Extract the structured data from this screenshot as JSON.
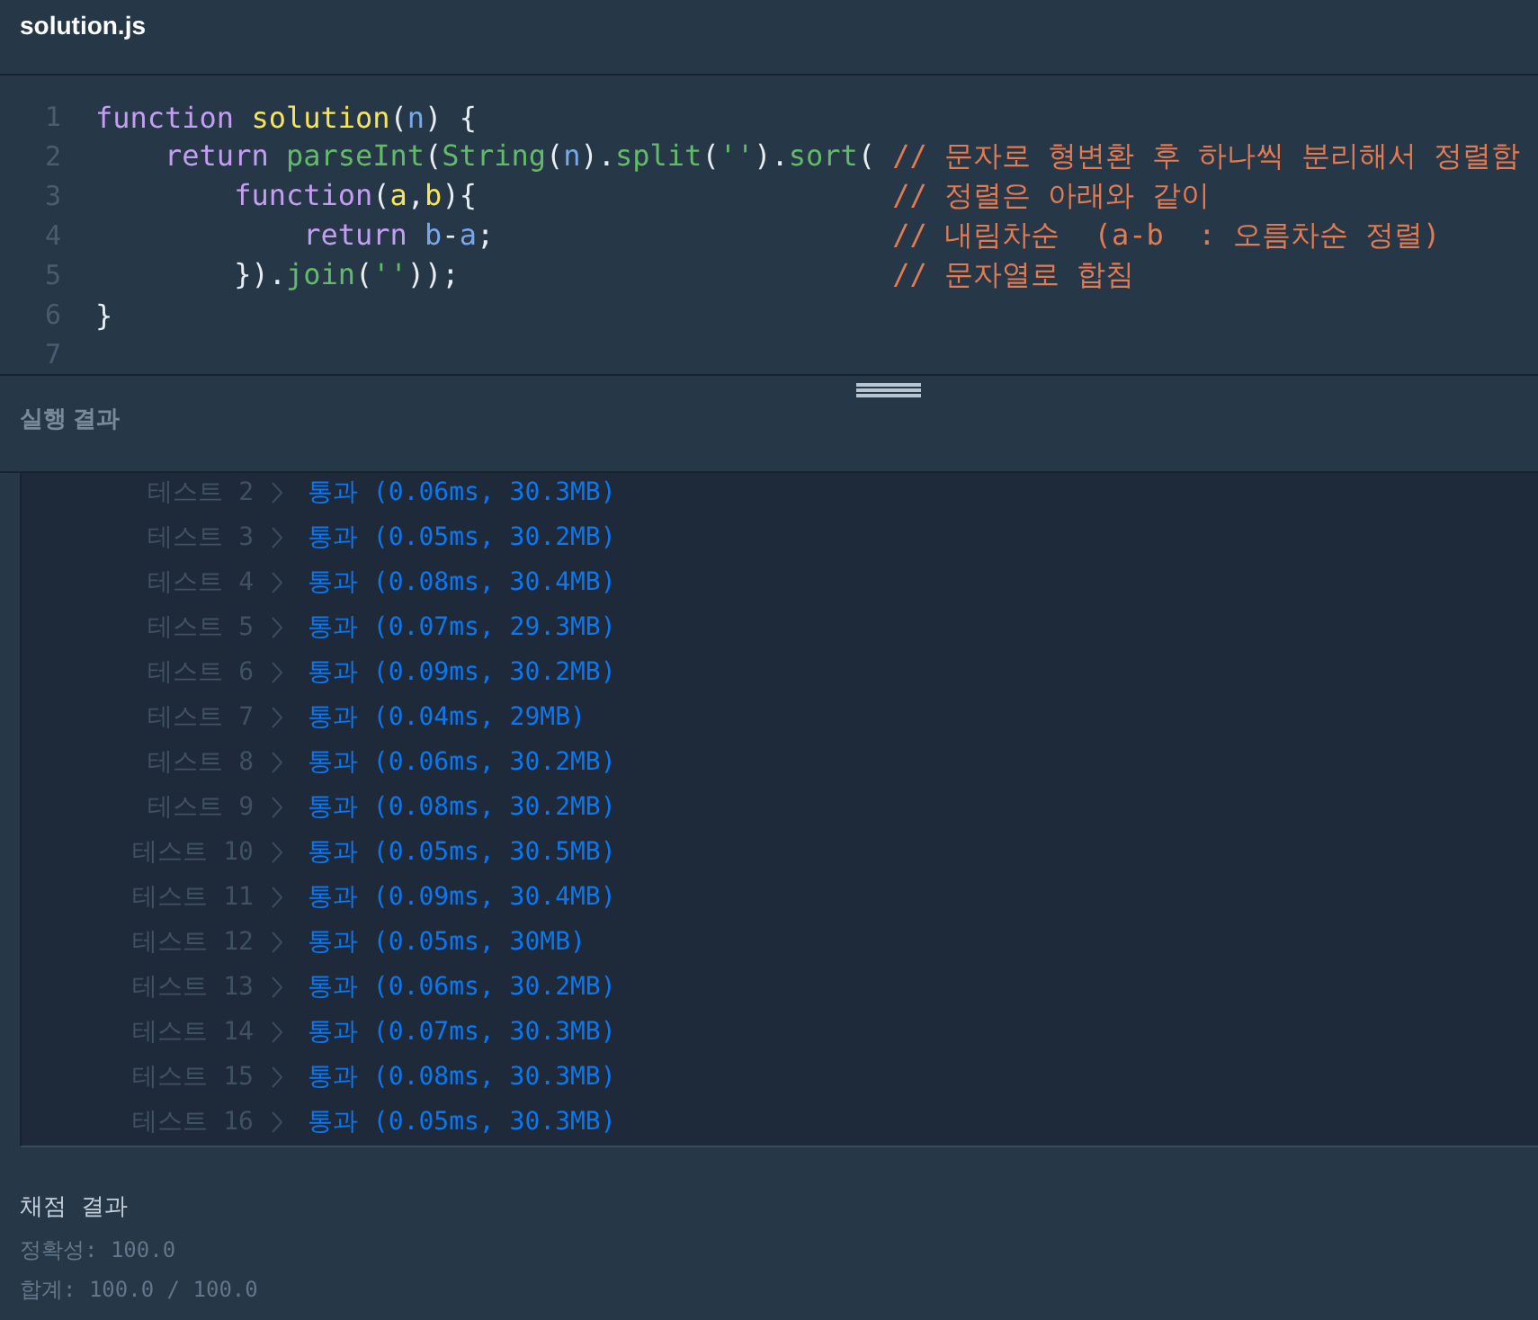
{
  "file_tab": {
    "title": "solution.js"
  },
  "editor": {
    "lines": [
      {
        "number": "1",
        "tokens": [
          {
            "kind": "keyword",
            "text": "function "
          },
          {
            "kind": "name",
            "text": "solution"
          },
          {
            "kind": "punct",
            "text": "("
          },
          {
            "kind": "param",
            "text": "n"
          },
          {
            "kind": "punct",
            "text": ") {"
          }
        ]
      },
      {
        "number": "2",
        "tokens": [
          {
            "kind": "keyword",
            "text": "    return "
          },
          {
            "kind": "call",
            "text": "parseInt"
          },
          {
            "kind": "punct",
            "text": "("
          },
          {
            "kind": "call",
            "text": "String"
          },
          {
            "kind": "punct",
            "text": "("
          },
          {
            "kind": "param",
            "text": "n"
          },
          {
            "kind": "punct",
            "text": ")."
          },
          {
            "kind": "call",
            "text": "split"
          },
          {
            "kind": "punct",
            "text": "("
          },
          {
            "kind": "call",
            "text": "''"
          },
          {
            "kind": "punct",
            "text": ")."
          },
          {
            "kind": "call",
            "text": "sort"
          },
          {
            "kind": "punct",
            "text": "( "
          },
          {
            "kind": "comment",
            "text": "// 문자로 형변환 후 하나씩 분리해서 정렬함"
          }
        ]
      },
      {
        "number": "3",
        "tokens": [
          {
            "kind": "keyword",
            "text": "        function"
          },
          {
            "kind": "punct",
            "text": "("
          },
          {
            "kind": "name",
            "text": "a"
          },
          {
            "kind": "punct",
            "text": ","
          },
          {
            "kind": "name",
            "text": "b"
          },
          {
            "kind": "punct",
            "text": "){                        "
          },
          {
            "kind": "comment",
            "text": "// 정렬은 아래와 같이"
          }
        ]
      },
      {
        "number": "4",
        "tokens": [
          {
            "kind": "keyword",
            "text": "            return "
          },
          {
            "kind": "param",
            "text": "b"
          },
          {
            "kind": "punct",
            "text": "-"
          },
          {
            "kind": "param",
            "text": "a"
          },
          {
            "kind": "punct",
            "text": ";                       "
          },
          {
            "kind": "comment",
            "text": "// 내림차순  (a-b  : 오름차순 정렬)"
          }
        ]
      },
      {
        "number": "5",
        "tokens": [
          {
            "kind": "punct",
            "text": "        })."
          },
          {
            "kind": "call",
            "text": "join"
          },
          {
            "kind": "punct",
            "text": "("
          },
          {
            "kind": "call",
            "text": "''"
          },
          {
            "kind": "punct",
            "text": "));                         "
          },
          {
            "kind": "comment",
            "text": "// 문자열로 합침"
          }
        ]
      },
      {
        "number": "6",
        "tokens": [
          {
            "kind": "punct",
            "text": "}"
          }
        ]
      },
      {
        "number": "7"
      }
    ]
  },
  "run_result": {
    "title": "실행 결과",
    "rows": [
      {
        "label": "테스트 2",
        "result": "통과 (0.06ms, 30.3MB)"
      },
      {
        "label": "테스트 3",
        "result": "통과 (0.05ms, 30.2MB)"
      },
      {
        "label": "테스트 4",
        "result": "통과 (0.08ms, 30.4MB)"
      },
      {
        "label": "테스트 5",
        "result": "통과 (0.07ms, 29.3MB)"
      },
      {
        "label": "테스트 6",
        "result": "통과 (0.09ms, 30.2MB)"
      },
      {
        "label": "테스트 7",
        "result": "통과 (0.04ms, 29MB)"
      },
      {
        "label": "테스트 8",
        "result": "통과 (0.06ms, 30.2MB)"
      },
      {
        "label": "테스트 9",
        "result": "통과 (0.08ms, 30.2MB)"
      },
      {
        "label": "테스트 10",
        "result": "통과 (0.05ms, 30.5MB)"
      },
      {
        "label": "테스트 11",
        "result": "통과 (0.09ms, 30.4MB)"
      },
      {
        "label": "테스트 12",
        "result": "통과 (0.05ms, 30MB)"
      },
      {
        "label": "테스트 13",
        "result": "통과 (0.06ms, 30.2MB)"
      },
      {
        "label": "테스트 14",
        "result": "통과 (0.07ms, 30.3MB)"
      },
      {
        "label": "테스트 15",
        "result": "통과 (0.08ms, 30.3MB)"
      },
      {
        "label": "테스트 16",
        "result": "통과 (0.05ms, 30.3MB)"
      }
    ]
  },
  "grading": {
    "title": "채점 결과",
    "lines": [
      "정확성: 100.0",
      "합계: 100.0 / 100.0"
    ]
  }
}
